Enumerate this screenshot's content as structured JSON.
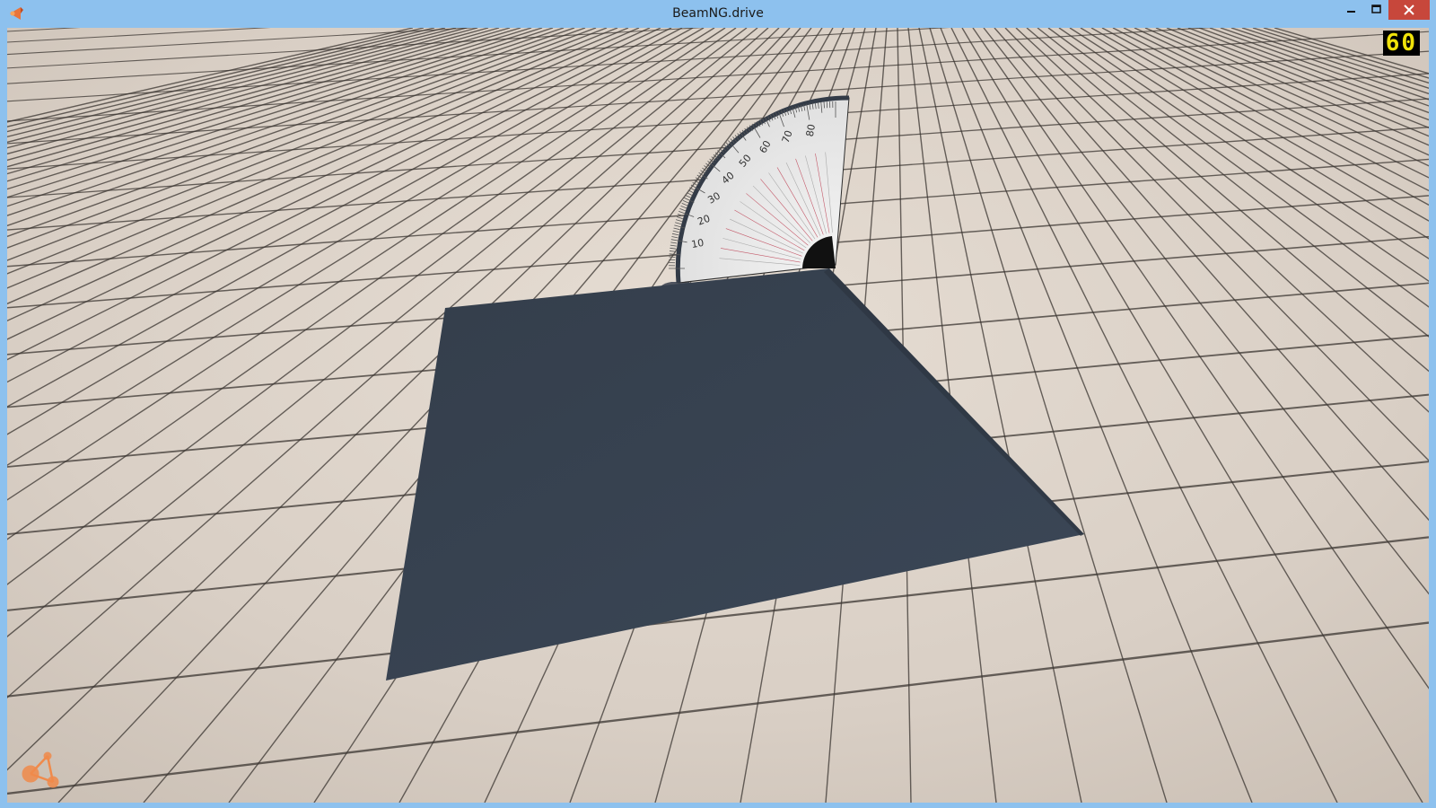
{
  "window": {
    "title": "BeamNG.drive"
  },
  "hud": {
    "fps": "60"
  },
  "protractor": {
    "labels": [
      "10",
      "20",
      "30",
      "40",
      "50",
      "60",
      "70",
      "80"
    ]
  },
  "icons": {
    "app": "beamng-app-icon",
    "minimize": "minimize-icon",
    "maximize": "maximize-icon",
    "close": "close-icon",
    "logo": "beamng-logo-icon"
  },
  "colors": {
    "frame": "#8dc1ee",
    "close_button": "#c7473b",
    "ground_tile": "#d8cec4",
    "grid_line": "#3a3430",
    "plate": "#38424f",
    "fps_text": "#f0e20a",
    "logo": "#f08a4b"
  }
}
